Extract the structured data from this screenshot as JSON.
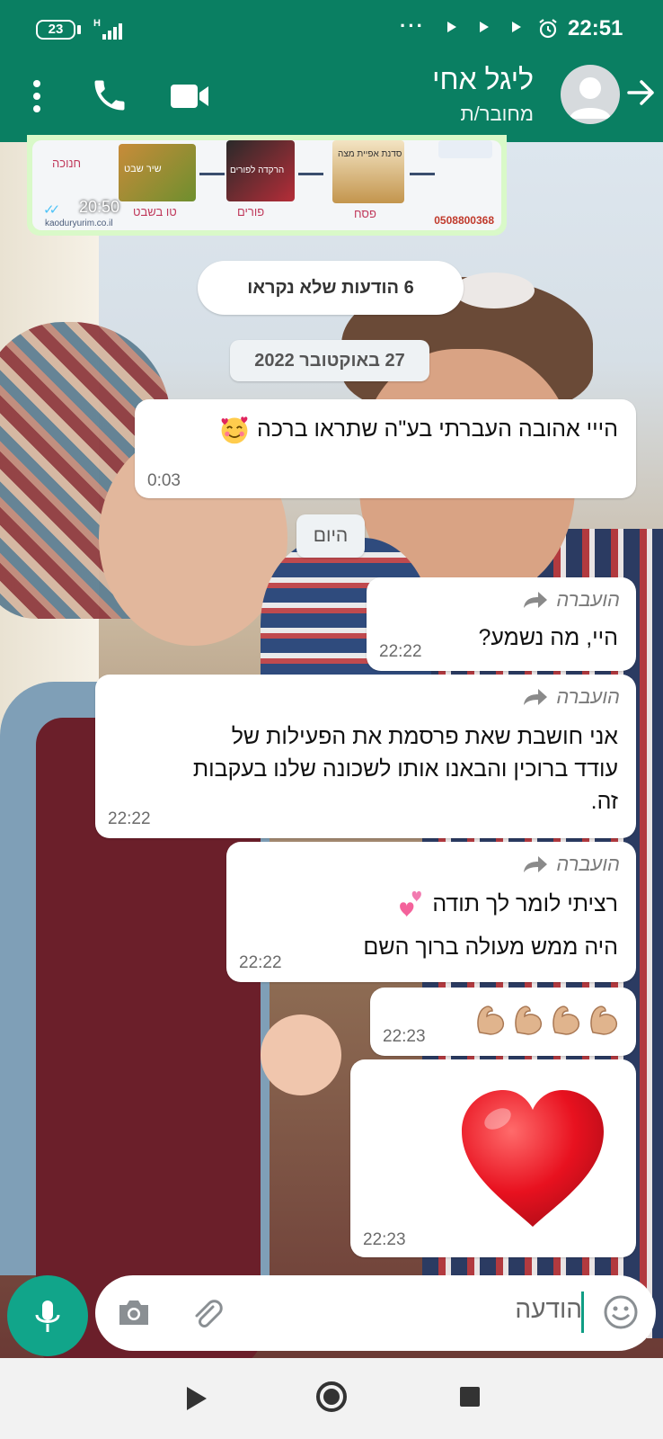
{
  "status_bar": {
    "battery": "23",
    "network": "H",
    "dots": "···",
    "time": "22:51"
  },
  "header": {
    "contact_name": "ליגל אחי",
    "status": "מחובר/ת"
  },
  "image_message": {
    "time": "20:50",
    "labels": [
      "חנוכה",
      "טו בשבט",
      "פורים",
      "פסח"
    ],
    "poster_texts": [
      "שיר שבט",
      "הרקדה לפורים",
      "סדנת אפיית מצה"
    ],
    "phone": "0508800368",
    "small_text": "kaoduryurim.co.il"
  },
  "unread_pill": "6 הודעות שלא נקראו",
  "date_pill": "27 באוקטובר 2022",
  "today_pill": "היום",
  "messages": [
    {
      "text": "הייי אהובה העברתי בע\"ה שתראו ברכה",
      "emoji": "smiling-face-with-hearts",
      "time": "0:03"
    },
    {
      "forwarded": "הועברה",
      "text": "היי, מה נשמע?",
      "time": "22:22"
    },
    {
      "forwarded": "הועברה",
      "lines": [
        "אני חושבת שאת פרסמת את הפעילות של",
        "עודד ברוכין והבאנו אותו לשכונה שלנו בעקבות",
        "זה."
      ],
      "time": "22:22"
    },
    {
      "forwarded": "הועברה",
      "lines": [
        "רציתי לומר לך תודה",
        "היה ממש מעולה ברוך השם"
      ],
      "emoji": "two-hearts",
      "time": "22:22"
    },
    {
      "emoji": "flexed-biceps x4",
      "time": "22:23"
    },
    {
      "emoji": "red-heart",
      "time": "22:23"
    }
  ],
  "input": {
    "placeholder": "הודעה"
  },
  "colors": {
    "header": "#0a7f62",
    "mic_button": "#11a58a",
    "outgoing_bubble": "#d9f9c8",
    "incoming_bubble": "#ffffff"
  },
  "icons": [
    "menu-icon",
    "phone-icon",
    "video-icon",
    "avatar-icon",
    "back-arrow-icon",
    "forward-icon",
    "mic-icon",
    "camera-icon",
    "attach-icon",
    "emoji-icon"
  ]
}
